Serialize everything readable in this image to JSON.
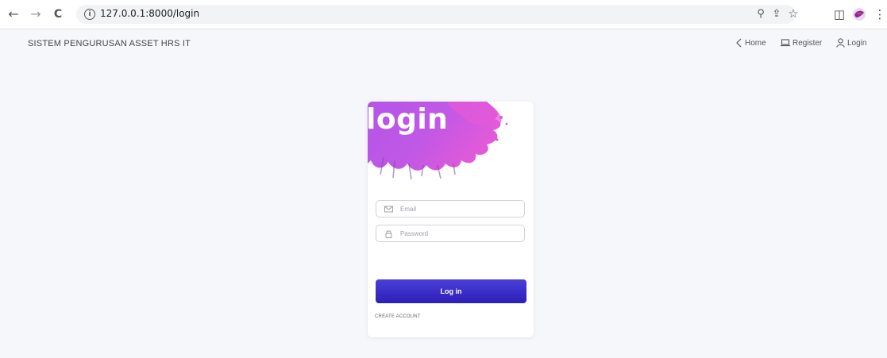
{
  "browser": {
    "url": "127.0.0.1:8000/login",
    "back_glyph": "←",
    "forward_glyph": "→",
    "reload_glyph": "C",
    "info_glyph": "i",
    "zoom_glyph": "⚲",
    "share_glyph": "⇪",
    "bookmark_glyph": "☆",
    "sidepanel_glyph": "◫",
    "menu_glyph": "⋮"
  },
  "navbar": {
    "brand": "SISTEM PENGURUSAN ASSET HRS IT",
    "links": [
      {
        "label": "Home",
        "icon": "chevron-left-icon"
      },
      {
        "label": "Register",
        "icon": "laptop-icon"
      },
      {
        "label": "Login",
        "icon": "user-icon"
      }
    ]
  },
  "login_card": {
    "title": "login",
    "email_placeholder": "Email",
    "password_placeholder": "Password",
    "submit_label": "Log in",
    "create_account_label": "CREATE ACCOUNT"
  },
  "colors": {
    "button": "#3327c4",
    "splash_pink": "#e35ad8",
    "splash_purple": "#b455e8",
    "background": "#f6f7fb"
  }
}
